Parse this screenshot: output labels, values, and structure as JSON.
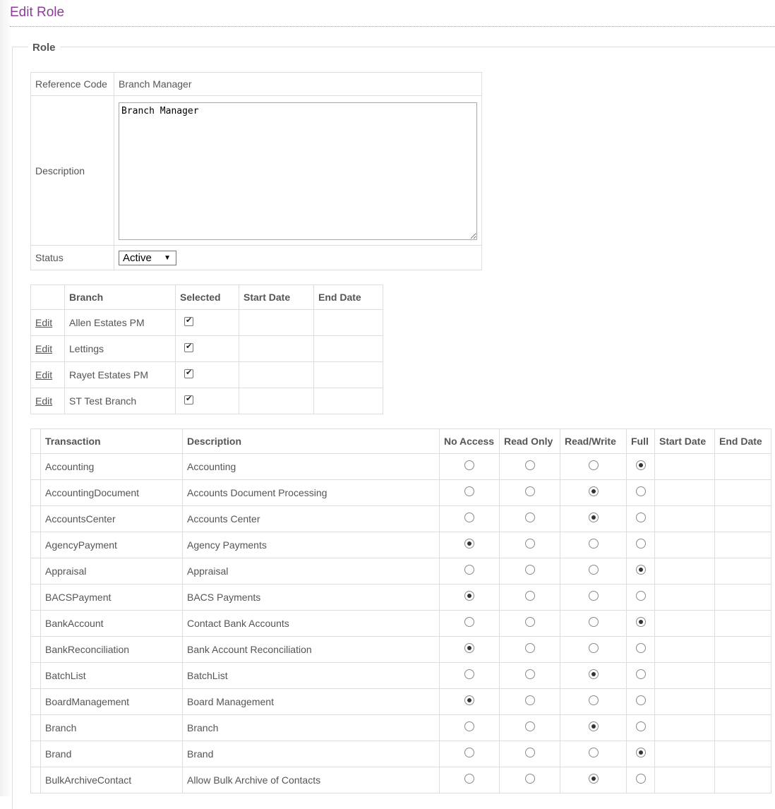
{
  "page": {
    "title": "Edit Role"
  },
  "role": {
    "legend": "Role",
    "reference_code_label": "Reference Code",
    "reference_code_value": "Branch Manager",
    "description_label": "Description",
    "description_value": "Branch Manager",
    "status_label": "Status",
    "status_value": "Active"
  },
  "branches": {
    "headers": [
      "",
      "Branch",
      "Selected",
      "Start Date",
      "End Date"
    ],
    "edit_label": "Edit",
    "rows": [
      {
        "name": "Allen Estates PM",
        "selected": true,
        "start": "",
        "end": ""
      },
      {
        "name": "Lettings",
        "selected": true,
        "start": "",
        "end": ""
      },
      {
        "name": "Rayet Estates PM",
        "selected": true,
        "start": "",
        "end": ""
      },
      {
        "name": "ST Test Branch",
        "selected": true,
        "start": "",
        "end": ""
      }
    ]
  },
  "transactions": {
    "headers": [
      "",
      "Transaction",
      "Description",
      "No Access",
      "Read Only",
      "Read/Write",
      "Full",
      "Start Date",
      "End Date"
    ],
    "access_levels": [
      "No Access",
      "Read Only",
      "Read/Write",
      "Full"
    ],
    "rows": [
      {
        "transaction": "Accounting",
        "description": "Accounting",
        "access": "Full"
      },
      {
        "transaction": "AccountingDocument",
        "description": "Accounts Document Processing",
        "access": "Read/Write"
      },
      {
        "transaction": "AccountsCenter",
        "description": "Accounts Center",
        "access": "Read/Write"
      },
      {
        "transaction": "AgencyPayment",
        "description": "Agency Payments",
        "access": "No Access"
      },
      {
        "transaction": "Appraisal",
        "description": "Appraisal",
        "access": "Full"
      },
      {
        "transaction": "BACSPayment",
        "description": "BACS Payments",
        "access": "No Access"
      },
      {
        "transaction": "BankAccount",
        "description": "Contact Bank Accounts",
        "access": "Full"
      },
      {
        "transaction": "BankReconciliation",
        "description": "Bank Account Reconciliation",
        "access": "No Access"
      },
      {
        "transaction": "BatchList",
        "description": "BatchList",
        "access": "Read/Write"
      },
      {
        "transaction": "BoardManagement",
        "description": "Board Management",
        "access": "No Access"
      },
      {
        "transaction": "Branch",
        "description": "Branch",
        "access": "Read/Write"
      },
      {
        "transaction": "Brand",
        "description": "Brand",
        "access": "Full"
      },
      {
        "transaction": "BulkArchiveContact",
        "description": "Allow Bulk Archive of Contacts",
        "access": "Read/Write"
      }
    ]
  },
  "colors": {
    "title": "#8e3c9a",
    "border": "#dddddd",
    "text": "#555555"
  }
}
